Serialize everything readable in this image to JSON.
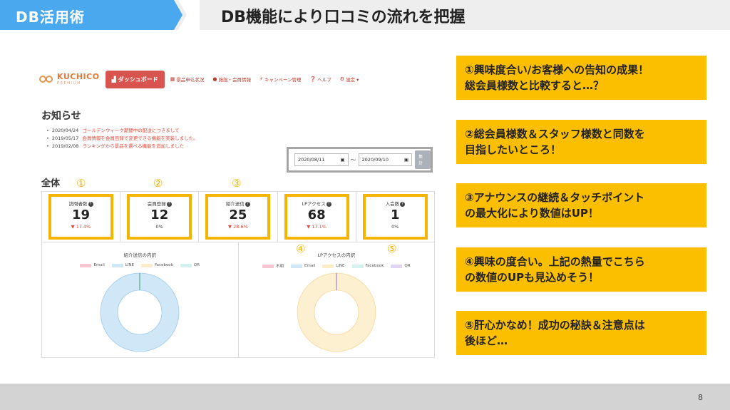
{
  "header": {
    "tag": "DB活用術",
    "title": "DB機能により口コミの流れを把握"
  },
  "app": {
    "logo": {
      "name": "KUCHICO",
      "sub": "PREMIUM"
    },
    "nav": {
      "dashboard": "ダッシュボード",
      "items": [
        {
          "icon": "grid-icon",
          "glyph": "▦",
          "label": "景品申込状況"
        },
        {
          "icon": "user-icon",
          "glyph": "●",
          "label": "施設・会員情報"
        },
        {
          "icon": "bolt-icon",
          "glyph": "⚡",
          "label": "キャンペーン管理"
        },
        {
          "icon": "help-icon",
          "glyph": "❓",
          "label": "ヘルプ"
        },
        {
          "icon": "gear-icon",
          "glyph": "⚙",
          "label": "設定 ▾"
        }
      ]
    },
    "news": {
      "title": "お知らせ",
      "items": [
        {
          "date": "2020/04/24",
          "text": "ゴールデンウィーク期間中の配送につきまして"
        },
        {
          "date": "2019/05/17",
          "text": "会員情報を会員目録で変更できる機能を実装しました。"
        },
        {
          "date": "2019/02/08",
          "text": "ランキングから景品を選べる機能を追加しました"
        }
      ]
    },
    "filter": {
      "from": "2020/08/11",
      "to": "2020/09/10",
      "sep": "〜",
      "button": "集計"
    },
    "total_label": "全体",
    "markers": [
      "①",
      "②",
      "③",
      "④",
      "⑤"
    ],
    "stats": [
      {
        "label": "訪問者数",
        "value": "19",
        "delta": "▼ 17.4%",
        "trend": "down"
      },
      {
        "label": "会員登録",
        "value": "12",
        "delta": "0%",
        "trend": "flat"
      },
      {
        "label": "紹介送信",
        "value": "25",
        "delta": "▼ 28.6%",
        "trend": "down"
      },
      {
        "label": "LPアクセス",
        "value": "68",
        "delta": "▼ 17.1%",
        "trend": "down"
      },
      {
        "label": "入会数",
        "value": "1",
        "delta": "0%",
        "trend": "flat"
      }
    ],
    "charts": [
      {
        "title": "紹介送信の内訳",
        "legend": [
          {
            "name": "Email",
            "color": "#f7c6d0"
          },
          {
            "name": "LINE",
            "color": "#cfe7f7"
          },
          {
            "name": "Facebook",
            "color": "#fcecc8"
          },
          {
            "name": "QR",
            "color": "#d3f1ee"
          }
        ],
        "slices": [
          {
            "name": "LINE",
            "fraction": 1.0,
            "color": "#cfe7f7",
            "stroke": "#9ecae8"
          }
        ],
        "divider_color": "#4a9a7a"
      },
      {
        "title": "LPアクセスの内訳",
        "legend": [
          {
            "name": "不明",
            "color": "#f7c6d0"
          },
          {
            "name": "Email",
            "color": "#cfe7f7"
          },
          {
            "name": "LINE",
            "color": "#fcecc8"
          },
          {
            "name": "Facebook",
            "color": "#d3f1ee"
          },
          {
            "name": "QR",
            "color": "#e3d6f5"
          }
        ],
        "slices": [
          {
            "name": "LINE",
            "fraction": 1.0,
            "color": "#fdf0d0",
            "stroke": "#f5d99a"
          }
        ],
        "divider_color": "#8a70c8"
      }
    ]
  },
  "callouts": [
    [
      "①興味度合い/お客様への告知の成果！",
      "総会員様数と比較すると…？"
    ],
    [
      "②総会員様数＆スタッフ様数と同数を",
      "目指したいところ！"
    ],
    [
      "③アナウンスの継続＆タッチポイント",
      "の最大化により数値はUP！"
    ],
    [
      "④興味の度合い。上記の熱量でこちら",
      "の数値のUPも見込めそう！"
    ],
    [
      "⑤肝心かなめ！成功の秘訣＆注意点は",
      "後ほど…"
    ]
  ],
  "footer": {
    "page": "8"
  },
  "colors": {
    "accent": "#fbbf00",
    "header_blue": "#4aa8ef",
    "nav_red": "#d9534f"
  }
}
